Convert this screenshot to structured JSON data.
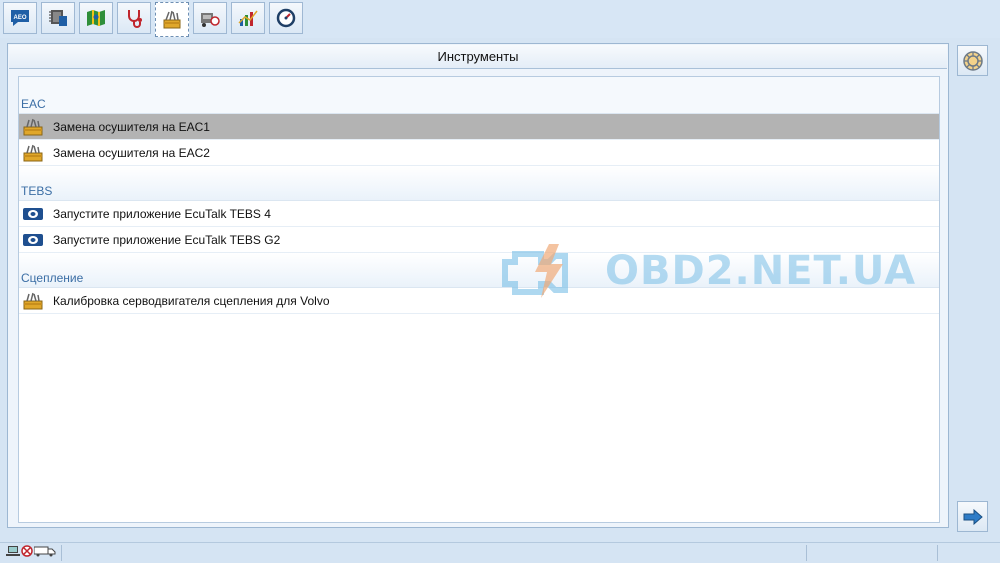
{
  "toolbar": {
    "tabs": [
      {
        "name": "tab-aeo",
        "icon": "aeo-speech-icon",
        "label": "AEO"
      },
      {
        "name": "tab-ecu",
        "icon": "ecu-chip-icon"
      },
      {
        "name": "tab-map",
        "icon": "map-icon"
      },
      {
        "name": "tab-diagnostics",
        "icon": "stethoscope-icon"
      },
      {
        "name": "tab-tools",
        "icon": "toolbox-icon",
        "active": true
      },
      {
        "name": "tab-vehicle",
        "icon": "vehicle-settings-icon"
      },
      {
        "name": "tab-chart",
        "icon": "bar-chart-icon"
      },
      {
        "name": "tab-gauge",
        "icon": "gauge-icon"
      }
    ]
  },
  "panel": {
    "title": "Инструменты",
    "groups": [
      {
        "title": "EAC",
        "items": [
          {
            "label": "Замена осушителя на EAC1",
            "icon": "toolbox-icon",
            "selected": true
          },
          {
            "label": "Замена осушителя на EAC2",
            "icon": "toolbox-icon"
          }
        ]
      },
      {
        "title": "TEBS",
        "items": [
          {
            "label": "Запустите приложение EcuTalk TEBS 4",
            "icon": "ecutalk-icon"
          },
          {
            "label": "Запустите приложение EcuTalk TEBS G2",
            "icon": "ecutalk-icon"
          }
        ]
      },
      {
        "title": "Сцепление",
        "items": [
          {
            "label": "Калибровка серводвигателя сцепления для Volvo",
            "icon": "toolbox-icon"
          }
        ]
      }
    ]
  },
  "side": {
    "top_button_icon": "settings-wheel-icon",
    "bottom_button_icon": "arrow-right-icon"
  },
  "watermark": {
    "text": "OBD2.NET.UA",
    "icon": "engine-check-icon"
  },
  "status": {
    "icons": [
      "laptop-icon",
      "disconnected-icon",
      "truck-icon"
    ]
  },
  "colors": {
    "accent": "#3b6ea5",
    "selected_row": "#b3b3b3",
    "background": "#d5e4f3"
  }
}
